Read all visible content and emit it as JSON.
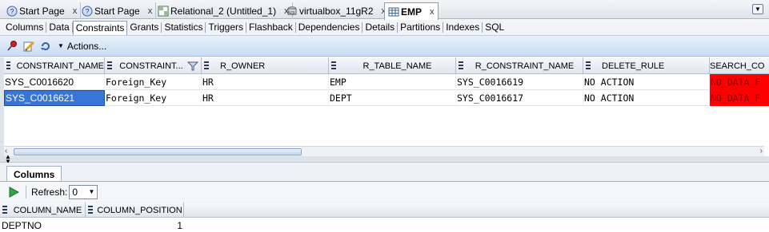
{
  "doc_tabs": [
    {
      "label": "Start Page",
      "icon": "help-icon",
      "close": "x",
      "active": false
    },
    {
      "label": "Start Page",
      "icon": "help-icon",
      "close": "x",
      "active": false
    },
    {
      "label": "Relational_2 (Untitled_1)",
      "icon": "relational-model-icon",
      "close": "x",
      "active": false
    },
    {
      "label": "virtualbox_11gR2",
      "icon": "sql-connection-icon",
      "close": "x",
      "active": false
    },
    {
      "label": "EMP",
      "icon": "table-icon",
      "close": "x",
      "active": true
    }
  ],
  "sub_tabs": [
    "Columns",
    "Data",
    "Constraints",
    "Grants",
    "Statistics",
    "Triggers",
    "Flashback",
    "Dependencies",
    "Details",
    "Partitions",
    "Indexes",
    "SQL"
  ],
  "active_sub_tab": "Constraints",
  "toolbar": {
    "actions_label": "Actions..."
  },
  "constraints_grid": {
    "headers": [
      "CONSTRAINT_NAME",
      "CONSTRAINT...",
      "R_OWNER",
      "R_TABLE_NAME",
      "R_CONSTRAINT_NAME",
      "DELETE_RULE",
      "SEARCH_CO"
    ],
    "rows": [
      [
        "SYS_C0016620",
        "Foreign_Key",
        "HR",
        "EMP",
        "SYS_C0016619",
        "NO ACTION",
        "NO_DATA_F"
      ],
      [
        "SYS_C0016621",
        "Foreign_Key",
        "HR",
        "DEPT",
        "SYS_C0016617",
        "NO ACTION",
        "NO_DATA_F"
      ]
    ]
  },
  "bottom_panel": {
    "tab_label": "Columns",
    "refresh_label": "Refresh:",
    "refresh_value": "0",
    "headers": [
      "COLUMN_NAME",
      "COLUMN_POSITION"
    ],
    "rows": [
      [
        "DEPTNO",
        "1"
      ]
    ]
  },
  "colors": {
    "selection": "#3875d7",
    "null_highlight": "#ff0000",
    "toolbar_blue": "#c9dcf1"
  }
}
